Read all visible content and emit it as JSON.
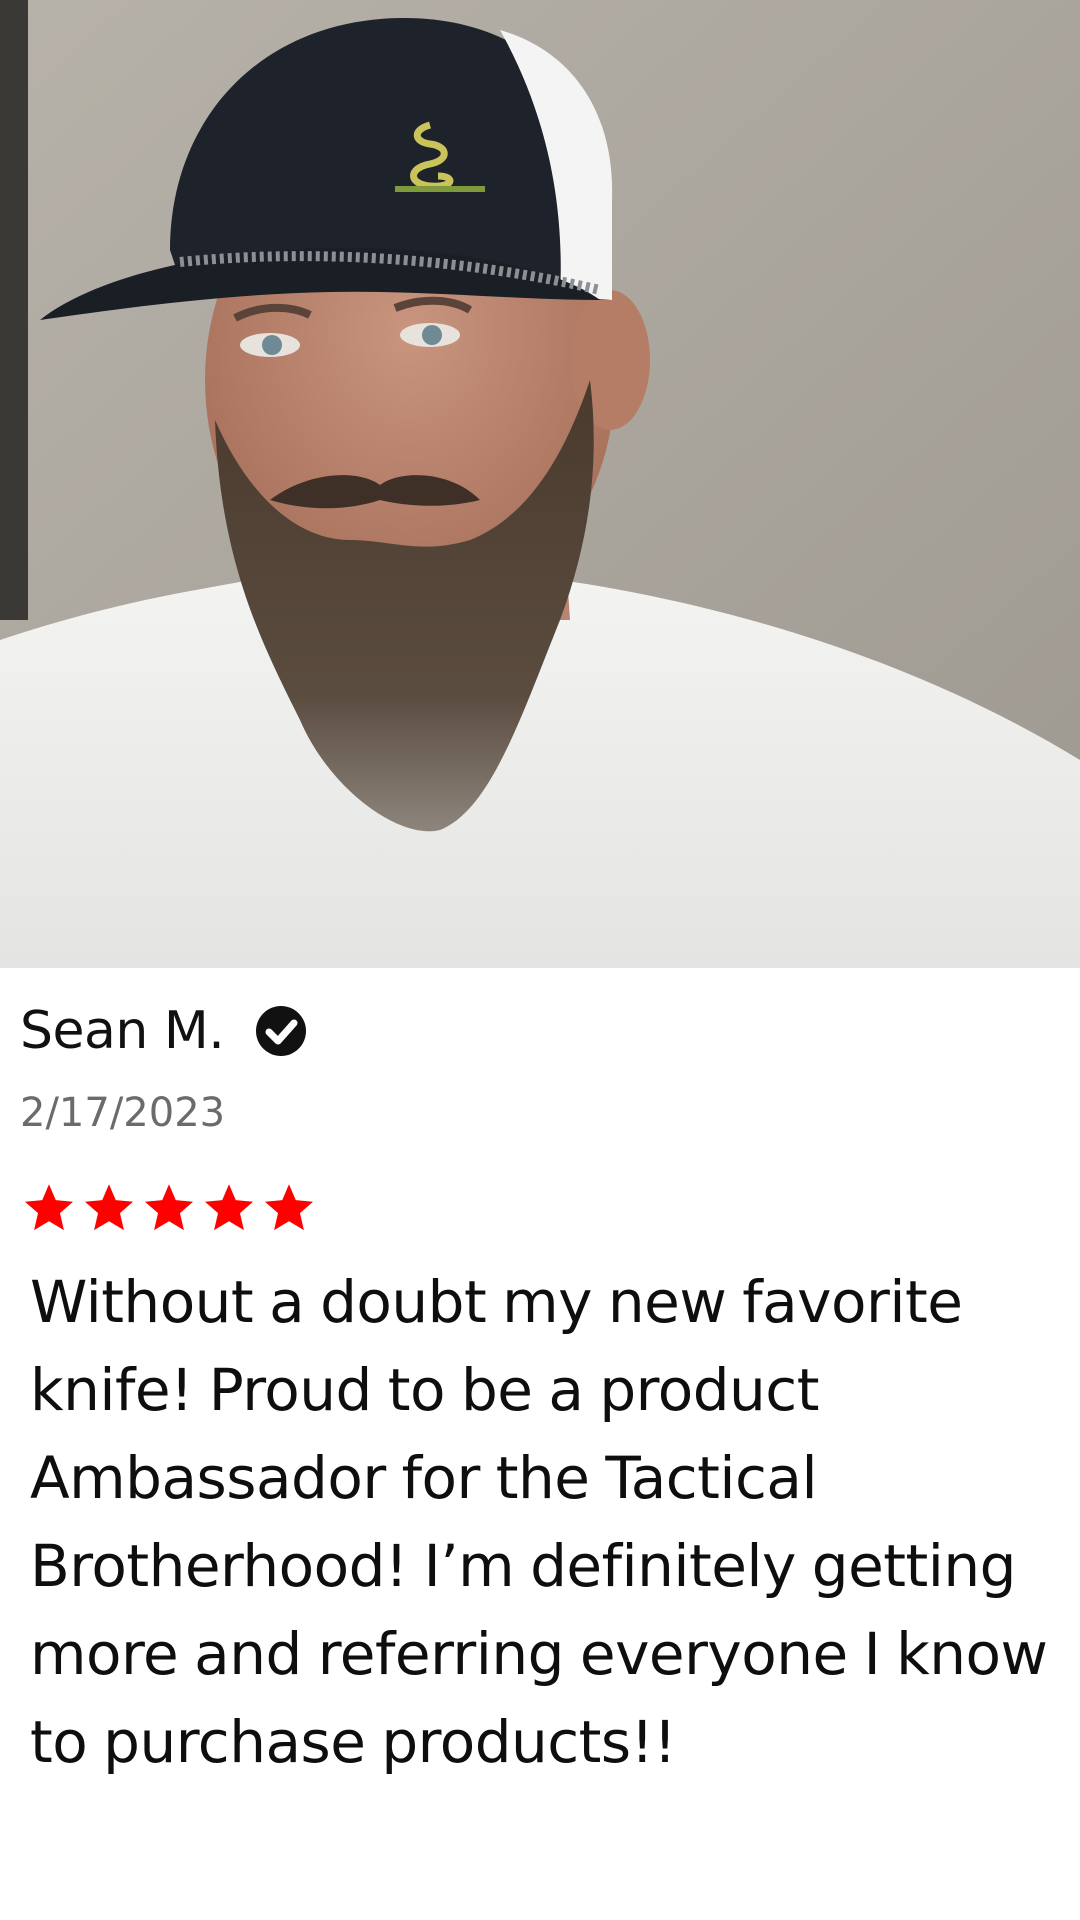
{
  "review": {
    "reviewer_name": "Sean M.",
    "verified_icon": "check-circle-icon",
    "date": "2/17/2023",
    "rating": 5,
    "rating_max": 5,
    "star_color": "#ff0000",
    "text": "Without a doubt my new favorite knife! Proud to be a product Ambassador for the Tactical Brotherhood! I’m definitely getting more and referring everyone I know to purchase products!!"
  }
}
